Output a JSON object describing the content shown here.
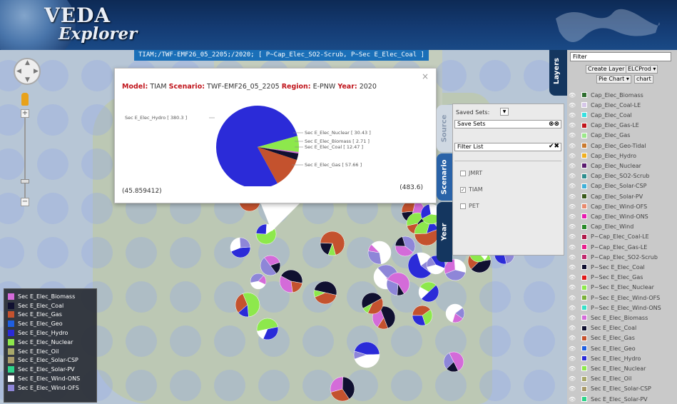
{
  "app": {
    "logo_line1": "VEDA",
    "logo_line2": "Explorer"
  },
  "strip_text": "TIAM;/TWF-EMF26_05_2205;/2020; [ P~Cap_Elec_SO2-Scrub, P~Sec E_Elec_Coal ]",
  "popup": {
    "close": "×",
    "model_key": "Model:",
    "model_val": "TIAM",
    "scenario_key": "Scenario:",
    "scenario_val": "TWF-EMF26_05_2205",
    "region_key": "Region:",
    "region_val": "E-PNW",
    "year_key": "Year:",
    "year_val": "2020",
    "coord_left": "(45.859412)",
    "coord_right": "(483.6)"
  },
  "chart_data": {
    "type": "pie",
    "slices": [
      {
        "label": "Sec E_Elec_Hydro [ 380.3 ]",
        "name": "Sec E_Elec_Hydro",
        "value": 380.3,
        "color": "#2b2bd8"
      },
      {
        "label": "Sec E_Elec_Nuclear [ 30.43 ]",
        "name": "Sec E_Elec_Nuclear",
        "value": 30.43,
        "color": "#8de84c"
      },
      {
        "label": "Sec E_Elec_Biomass [ 2.71 ]",
        "name": "Sec E_Elec_Biomass",
        "value": 2.71,
        "color": "#d46bd9"
      },
      {
        "label": "Sec E_Elec_Coal [ 12.47 ]",
        "name": "Sec E_Elec_Coal",
        "value": 12.47,
        "color": "#101030"
      },
      {
        "label": "Sec E_Elec_Gas [ 57.66 ]",
        "name": "Sec E_Elec_Gas",
        "value": 57.66,
        "color": "#c4522e"
      }
    ]
  },
  "legend": [
    {
      "label": "Sec E_Elec_Biomass",
      "color": "#d46bd9"
    },
    {
      "label": "Sec E_Elec_Coal",
      "color": "#101030"
    },
    {
      "label": "Sec E_Elec_Gas",
      "color": "#c4522e"
    },
    {
      "label": "Sec E_Elec_Geo",
      "color": "#1f5fe0"
    },
    {
      "label": "Sec E_Elec_Hydro",
      "color": "#2b2bd8"
    },
    {
      "label": "Sec E_Elec_Nuclear",
      "color": "#8de84c"
    },
    {
      "label": "Sec E_Elec_Oil",
      "color": "#a8a86a"
    },
    {
      "label": "Sec E_Elec_Solar-CSP",
      "color": "#a89a6a"
    },
    {
      "label": "Sec E_Elec_Solar-PV",
      "color": "#2fd48a"
    },
    {
      "label": "Sec E_Elec_Wind-ONS",
      "color": "#ffffff"
    },
    {
      "label": "Sec E_Elec_Wind-OFS",
      "color": "#8e86d8"
    }
  ],
  "sidebar": {
    "filter_placeholder": "Filter",
    "create_layer": "Create Layer",
    "elcprod": "ELCProd",
    "pie_chart": "Pie Chart",
    "chart": "chart",
    "layers_tab": "Layers",
    "items": [
      {
        "label": "Cap_Elec_Biomass",
        "color": "#2f6e2f"
      },
      {
        "label": "Cap_Elec_Coal-LE",
        "color": "#d6c7e8"
      },
      {
        "label": "Cap_Elec_Coal",
        "color": "#37e0e0"
      },
      {
        "label": "Cap_Elec_Gas-LE",
        "color": "#c0141b"
      },
      {
        "label": "Cap_Elec_Gas",
        "color": "#9be88a"
      },
      {
        "label": "Cap_Elec_Geo-Tidal",
        "color": "#c97a2f"
      },
      {
        "label": "Cap_Elec_Hydro",
        "color": "#f0b020"
      },
      {
        "label": "Cap_Elec_Nuclear",
        "color": "#5a1a6e"
      },
      {
        "label": "Cap_Elec_SO2-Scrub",
        "color": "#2f8e8e"
      },
      {
        "label": "Cap_Elec_Solar-CSP",
        "color": "#40b0d8"
      },
      {
        "label": "Cap_Elec_Solar-PV",
        "color": "#3a5a1a"
      },
      {
        "label": "Cap_Elec_Wind-OFS",
        "color": "#e88a6e"
      },
      {
        "label": "Cap_Elec_Wind-ONS",
        "color": "#e81ab0"
      },
      {
        "label": "Cap_Elec_Wind",
        "color": "#2a8a2a"
      },
      {
        "label": "P~Cap_Elec_Coal-LE",
        "color": "#b01a4a"
      },
      {
        "label": "P~Cap_Elec_Gas-LE",
        "color": "#e8208e"
      },
      {
        "label": "P~Cap_Elec_SO2-Scrub",
        "color": "#c02a6e"
      },
      {
        "label": "P~Sec E_Elec_Coal",
        "color": "#101030"
      },
      {
        "label": "P~Sec E_Elec_Gas",
        "color": "#e01a1a"
      },
      {
        "label": "P~Sec E_Elec_Nuclear",
        "color": "#8de84c"
      },
      {
        "label": "P~Sec E_Elec_Wind-OFS",
        "color": "#7ab03a"
      },
      {
        "label": "P~Sec E_Elec_Wind-ONS",
        "color": "#37e0c8"
      },
      {
        "label": "Sec E_Elec_Biomass",
        "color": "#d46bd9"
      },
      {
        "label": "Sec E_Elec_Coal",
        "color": "#101030"
      },
      {
        "label": "Sec E_Elec_Gas",
        "color": "#c4522e"
      },
      {
        "label": "Sec E_Elec_Geo",
        "color": "#1f5fe0"
      },
      {
        "label": "Sec E_Elec_Hydro",
        "color": "#2b2bd8"
      },
      {
        "label": "Sec E_Elec_Nuclear",
        "color": "#8de84c"
      },
      {
        "label": "Sec E_Elec_Oil",
        "color": "#a8a86a"
      },
      {
        "label": "Sec E_Elec_Solar-CSP",
        "color": "#a89a6a"
      },
      {
        "label": "Sec E_Elec_Solar-PV",
        "color": "#2fd48a"
      }
    ]
  },
  "panel": {
    "source_tab": "Source",
    "scenario_tab": "Scenario",
    "year_tab": "Year",
    "saved_sets_label": "Saved Sets:",
    "save_sets": "Save Sets",
    "filter_list": "Filter List",
    "scenarios": [
      {
        "label": "JMRT",
        "checked": false
      },
      {
        "label": "TIAM",
        "checked": true
      },
      {
        "label": "PET",
        "checked": false
      }
    ]
  }
}
